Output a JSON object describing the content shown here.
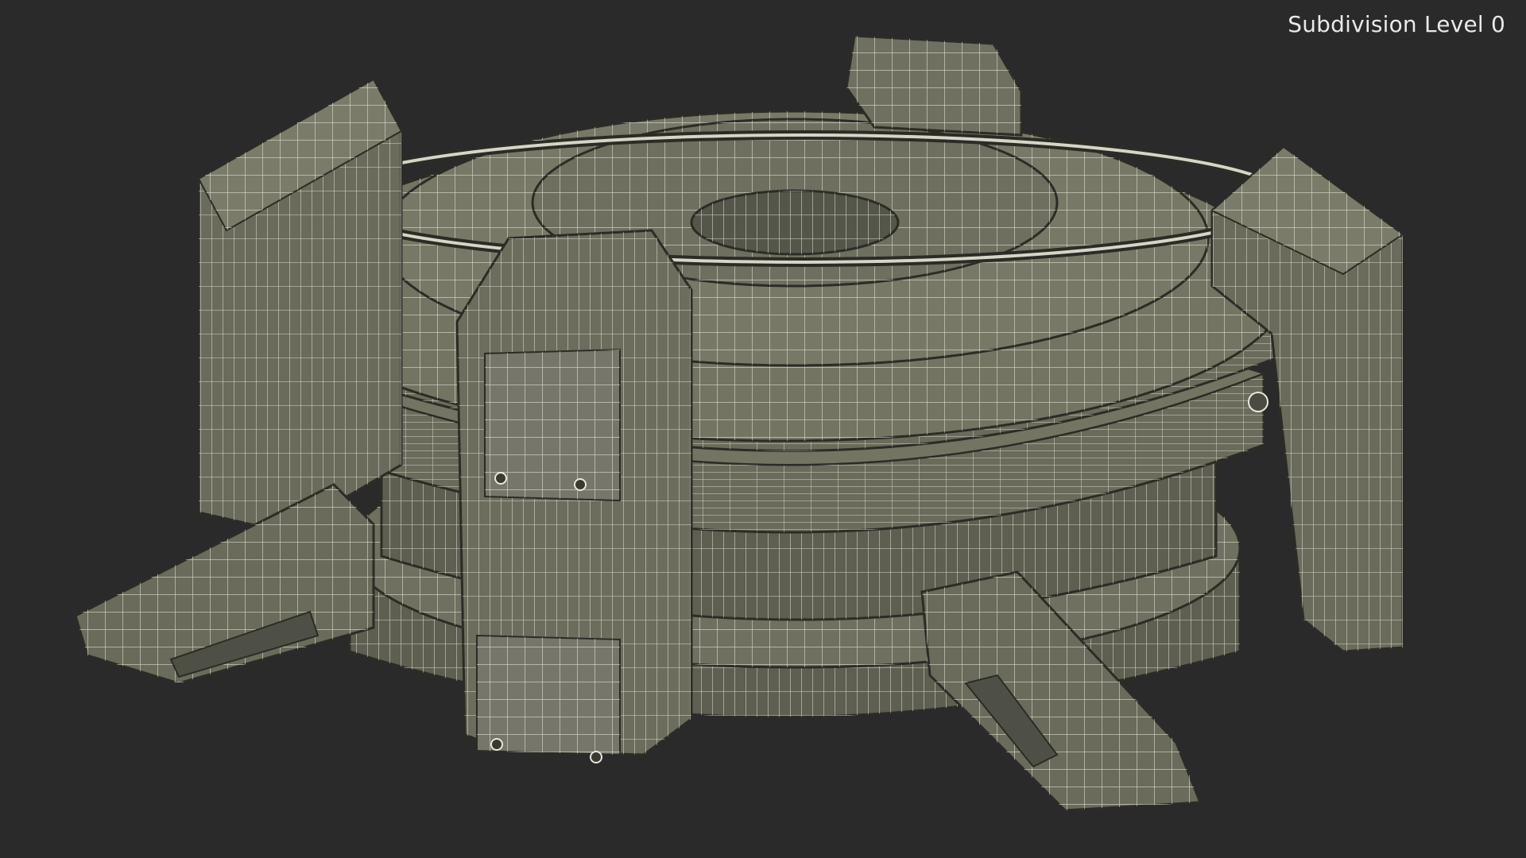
{
  "viewport": {
    "overlay_label": "Subdivision Level 0"
  },
  "model": {
    "render_mode": "wireframe-on-shaded",
    "icon": "wireframe-mesh-icon"
  },
  "colors": {
    "background": "#2a2a2a",
    "surface": "#6f705f",
    "surface_dark": "#5a5b4c",
    "surface_light": "#7b7c6a",
    "wire": "#e8e7da",
    "edge": "#2c2c26"
  }
}
